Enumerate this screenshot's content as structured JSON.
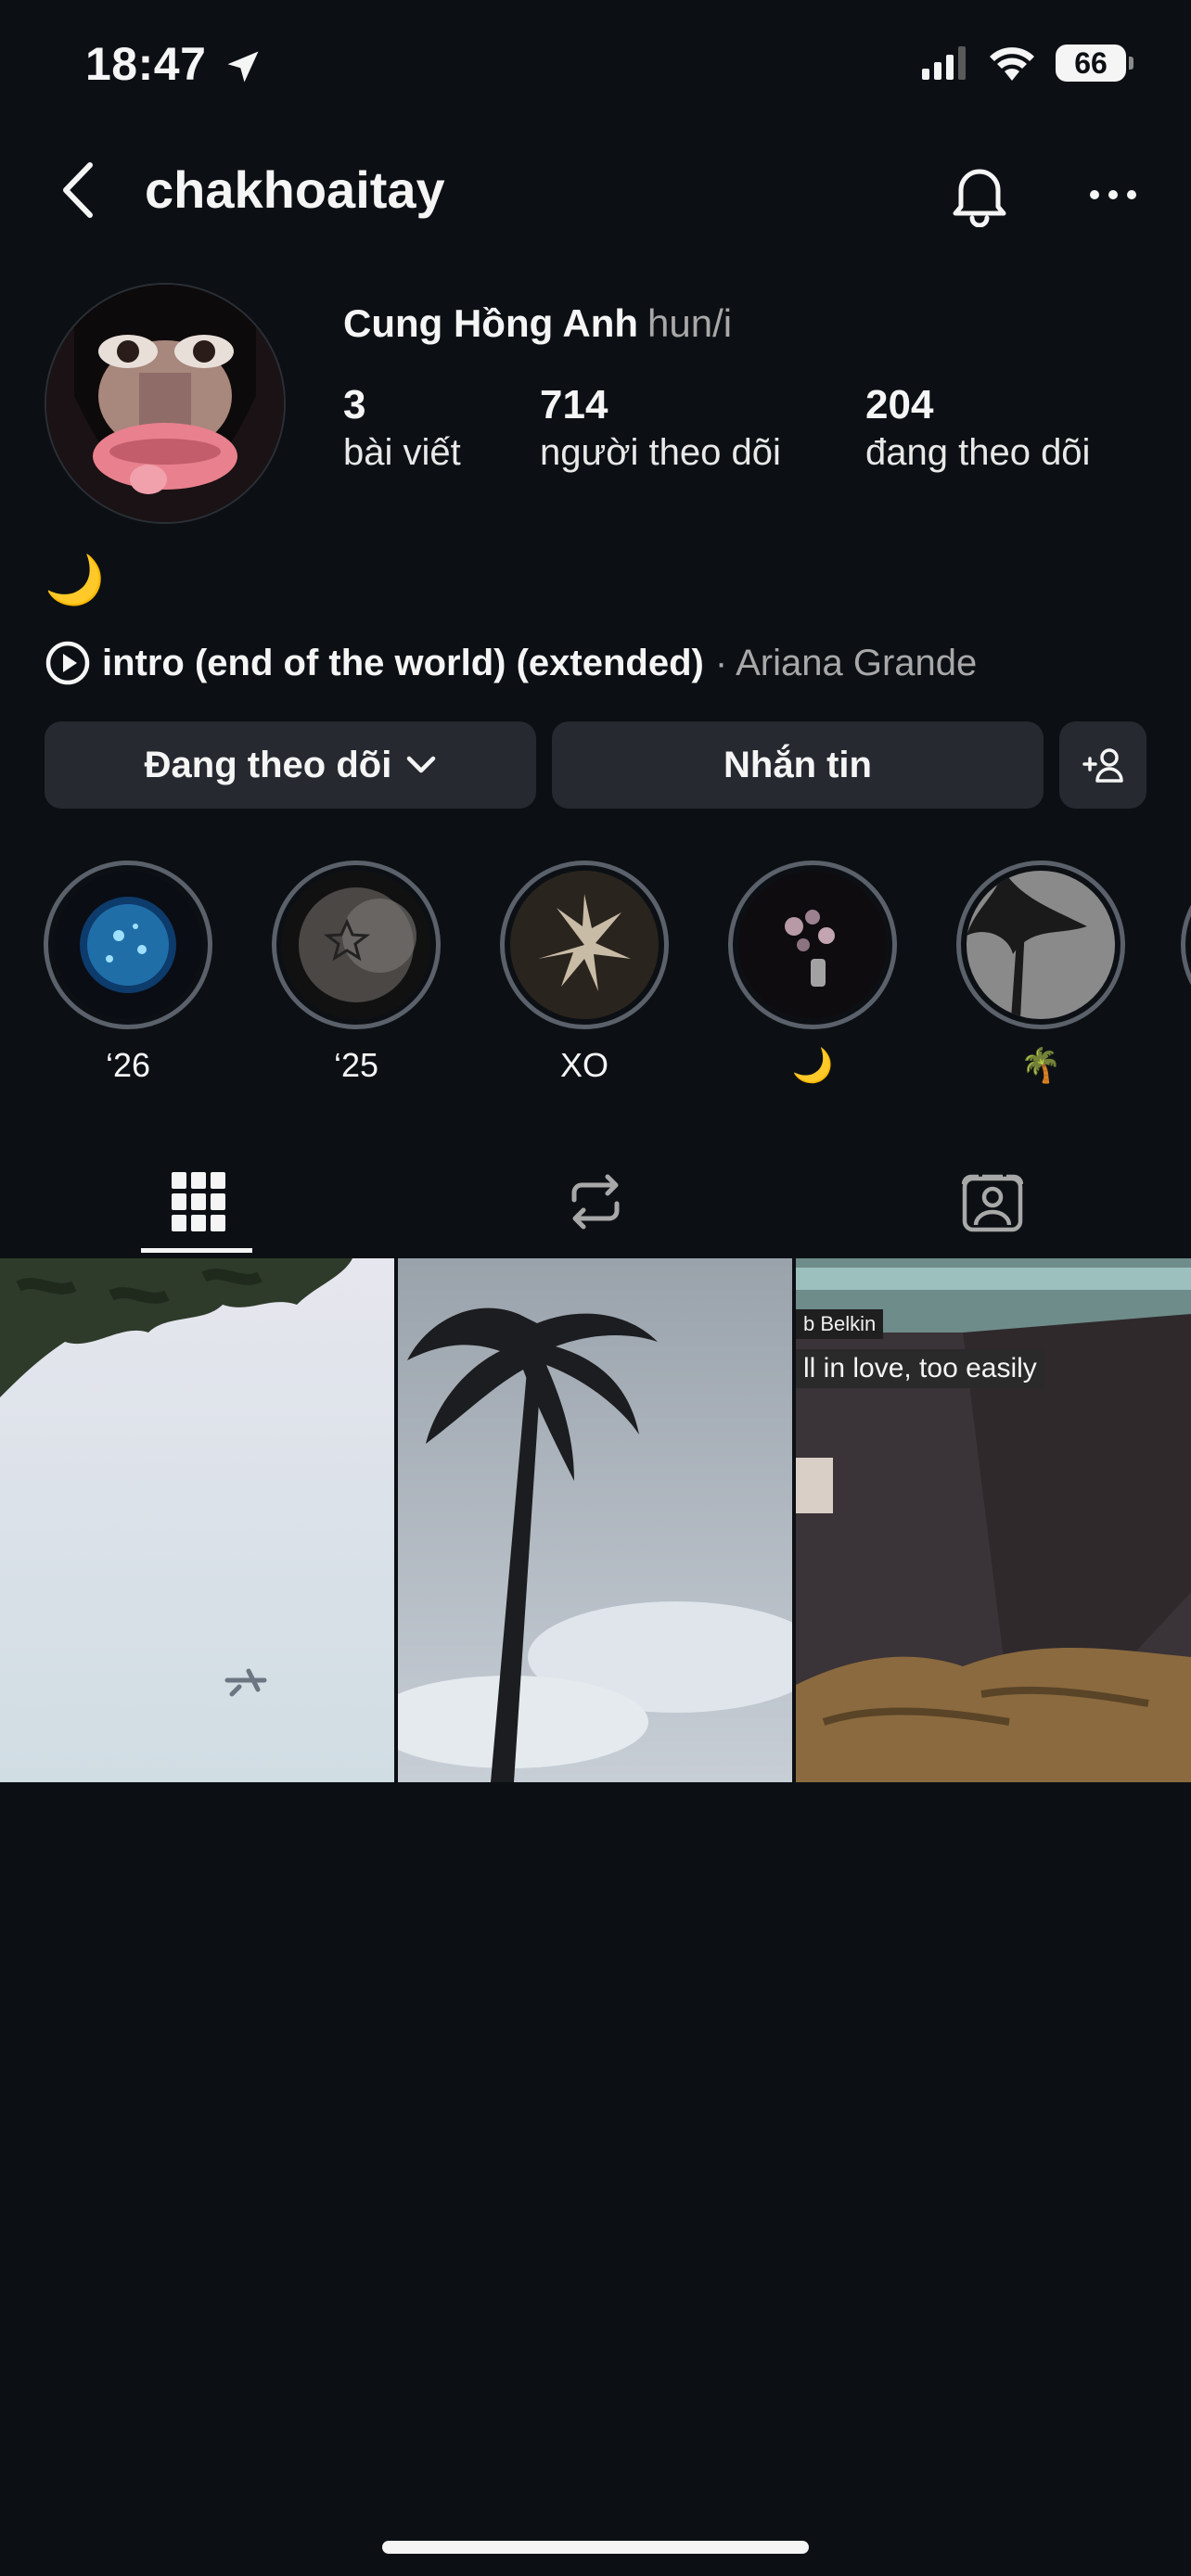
{
  "status_bar": {
    "time": "18:47",
    "battery": "66"
  },
  "header": {
    "username": "chakhoaitay"
  },
  "profile": {
    "display_name": "Cung Hồng Anh",
    "pronouns": "hun/i",
    "stats": [
      {
        "value": "3",
        "label": "bài viết"
      },
      {
        "value": "714",
        "label": "người theo dõi"
      },
      {
        "value": "204",
        "label": "đang theo dõi"
      }
    ],
    "bio": "🌙",
    "music": {
      "title": "intro (end of the world) (extended)",
      "artist": "· Ariana Grande"
    }
  },
  "actions": {
    "following_label": "Đang theo dõi",
    "message_label": "Nhắn tin"
  },
  "highlights": [
    {
      "label": "‘26"
    },
    {
      "label": "‘25"
    },
    {
      "label": "XO"
    },
    {
      "label": "🌙"
    },
    {
      "label": "🌴"
    }
  ],
  "posts": [
    {
      "caption_tag": "",
      "caption": ""
    },
    {
      "caption_tag": "",
      "caption": ""
    },
    {
      "caption_tag": "b Belkin",
      "caption": "ll in love, too easily"
    }
  ],
  "colors": {
    "background": "#0c1014",
    "button": "#262a30",
    "secondary_text": "#a8a8a8"
  }
}
